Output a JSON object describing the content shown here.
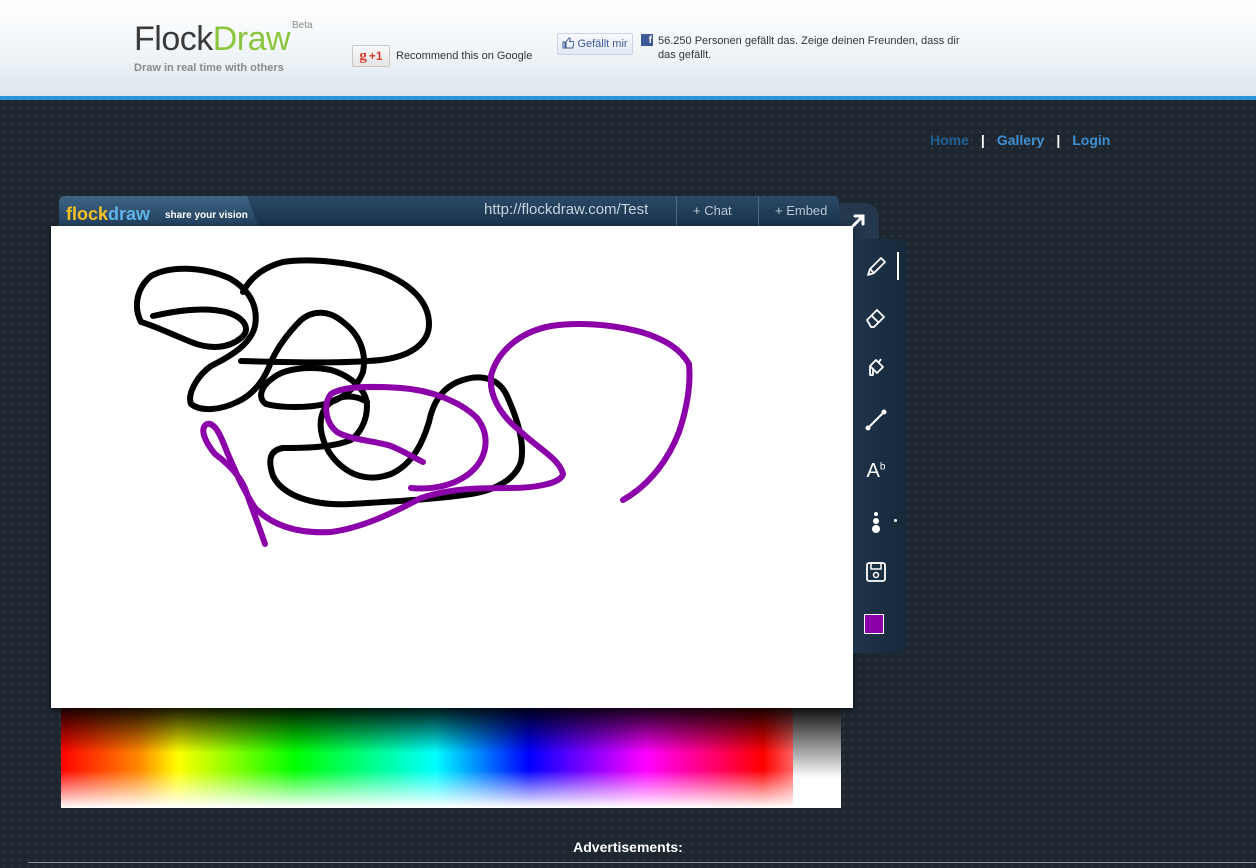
{
  "header": {
    "logo_flock": "Flock",
    "logo_draw": "Draw",
    "logo_beta": "Beta",
    "tagline": "Draw in real time with others",
    "gplus_label": "+1",
    "gplus_text": "Recommend this on Google",
    "fb_like_label": "Gefällt mir",
    "fb_text": "56.250 Personen gefällt das. Zeige deinen Freunden, dass dir das gefällt."
  },
  "nav": {
    "home": "Home",
    "sep1": "|",
    "gallery": "Gallery",
    "sep2": "|",
    "login": "Login"
  },
  "app": {
    "brand_flock": "flock",
    "brand_draw": "draw",
    "brand_tagline": "share your vision",
    "url": "http://flockdraw.com/Test",
    "chat_tab": "+ Chat",
    "embed_tab": "+ Embed"
  },
  "toolbar": {
    "tools": [
      "brush-icon",
      "eraser-icon",
      "fill-bucket-icon",
      "line-icon",
      "text-icon",
      "brush-size-icon",
      "save-icon"
    ],
    "selected_color": "#8b00a8",
    "text_tool_glyph": "A",
    "text_tool_sup": "b"
  },
  "canvas": {
    "stroke_colors": [
      "#000000",
      "#8b00a8"
    ]
  },
  "footer": {
    "ads_label": "Advertisements:"
  }
}
